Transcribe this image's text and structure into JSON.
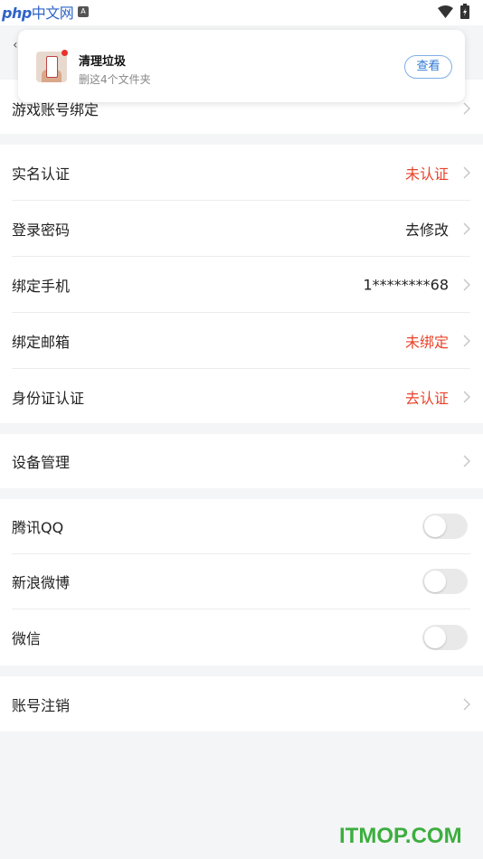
{
  "status_bar": {
    "logo_text": "php",
    "logo_cn": "中文网",
    "badge": "A",
    "icons": [
      "wifi-icon",
      "battery-icon"
    ]
  },
  "notification": {
    "title": "清理垃圾",
    "subtitle": "删这4个文件夹",
    "action_label": "查看",
    "accent_color": "#2d78d8",
    "dot_color": "#e8322b"
  },
  "settings": {
    "game_binding": {
      "label": "游戏账号绑定"
    },
    "account_rows": [
      {
        "label": "实名认证",
        "value": "未认证",
        "highlight": true
      },
      {
        "label": "登录密码",
        "value": "去修改",
        "highlight": false
      },
      {
        "label": "绑定手机",
        "value": "1********68",
        "highlight": false
      },
      {
        "label": "绑定邮箱",
        "value": "未绑定",
        "highlight": true
      },
      {
        "label": "身份证认证",
        "value": "去认证",
        "highlight": true
      }
    ],
    "device": {
      "label": "设备管理"
    },
    "social": [
      {
        "label": "腾讯QQ",
        "enabled": false
      },
      {
        "label": "新浪微博",
        "enabled": false
      },
      {
        "label": "微信",
        "enabled": false
      }
    ],
    "cancel_account": {
      "label": "账号注销"
    },
    "highlight_color": "#e9432a"
  },
  "watermark": "ITMOP.COM"
}
